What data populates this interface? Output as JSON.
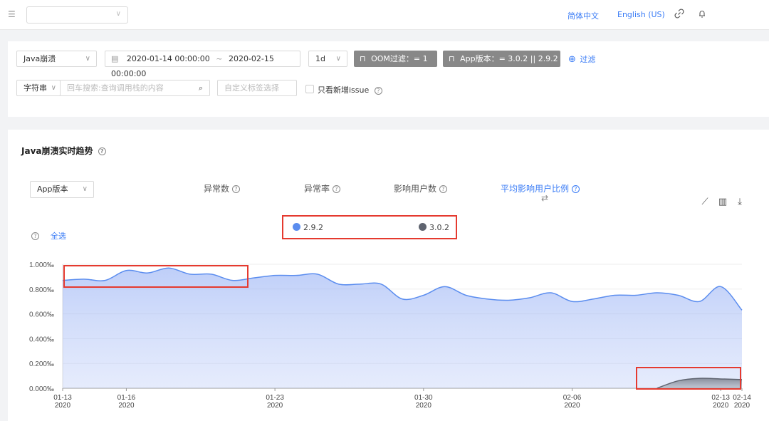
{
  "topnav": {
    "lang_zh": "简体中文",
    "lang_en": "English (US)",
    "icons": [
      "menu-icon",
      "link-icon",
      "bell-icon"
    ]
  },
  "filters": {
    "crash_type": "Java崩溃",
    "date_start": "2020-01-14 00:00:00",
    "date_sep": "~",
    "date_end": "2020-02-15 00:00:00",
    "granularity": "1d",
    "oom_chip": "OOM过滤：= 1",
    "version_chip": "App版本：= 3.0.2 || 2.9.2",
    "add_filter": "过滤",
    "search_type": "字符串",
    "search_placeholder": "回车搜索:查询调用栈的内容",
    "tag_placeholder": "自定义标签选择",
    "only_new_label": "只看新增issue"
  },
  "trend": {
    "title": "Java崩溃实时趋势",
    "group_by": "App版本",
    "metrics": [
      "异常数",
      "异常率",
      "影响用户数",
      "平均影响用户比例"
    ],
    "select_all": "全选",
    "legend": [
      {
        "name": "2.9.2",
        "color": "#5b8def"
      },
      {
        "name": "3.0.2",
        "color": "#5f6470"
      }
    ]
  },
  "chart_data": {
    "type": "area",
    "y_unit": "‰",
    "y_ticks": [
      "0.000‰",
      "0.200‰",
      "0.400‰",
      "0.600‰",
      "0.800‰",
      "1.000‰"
    ],
    "ylim": [
      0,
      1.0
    ],
    "x_ticks": [
      {
        "date": "01-13",
        "year": "2020"
      },
      {
        "date": "01-16",
        "year": "2020"
      },
      {
        "date": "01-23",
        "year": "2020"
      },
      {
        "date": "01-30",
        "year": "2020"
      },
      {
        "date": "02-06",
        "year": "2020"
      },
      {
        "date": "02-13",
        "year": "2020"
      },
      {
        "date": "02-14",
        "year": "2020"
      }
    ],
    "x": [
      "01-13",
      "01-14",
      "01-15",
      "01-16",
      "01-17",
      "01-18",
      "01-19",
      "01-20",
      "01-21",
      "01-22",
      "01-23",
      "01-24",
      "01-25",
      "01-26",
      "01-27",
      "01-28",
      "01-29",
      "01-30",
      "01-31",
      "02-01",
      "02-02",
      "02-03",
      "02-04",
      "02-05",
      "02-06",
      "02-07",
      "02-08",
      "02-09",
      "02-10",
      "02-11",
      "02-12",
      "02-13",
      "02-14"
    ],
    "series": [
      {
        "name": "2.9.2",
        "color": "#5b8def",
        "values": [
          0.87,
          0.88,
          0.87,
          0.95,
          0.93,
          0.97,
          0.92,
          0.92,
          0.87,
          0.89,
          0.91,
          0.91,
          0.92,
          0.84,
          0.84,
          0.84,
          0.72,
          0.75,
          0.82,
          0.75,
          0.72,
          0.71,
          0.73,
          0.77,
          0.7,
          0.72,
          0.75,
          0.75,
          0.77,
          0.75,
          0.7,
          0.82,
          0.63
        ]
      },
      {
        "name": "3.0.2",
        "color": "#5f6470",
        "values": [
          0,
          0,
          0,
          0,
          0,
          0,
          0,
          0,
          0,
          0,
          0,
          0,
          0,
          0,
          0,
          0,
          0,
          0,
          0,
          0,
          0,
          0,
          0,
          0,
          0,
          0,
          0,
          0,
          0,
          0.06,
          0.08,
          0.075,
          0.07
        ]
      }
    ],
    "highlights": [
      "top-left peak region of 2.9.2",
      "3.0.2 appearing at end"
    ]
  }
}
